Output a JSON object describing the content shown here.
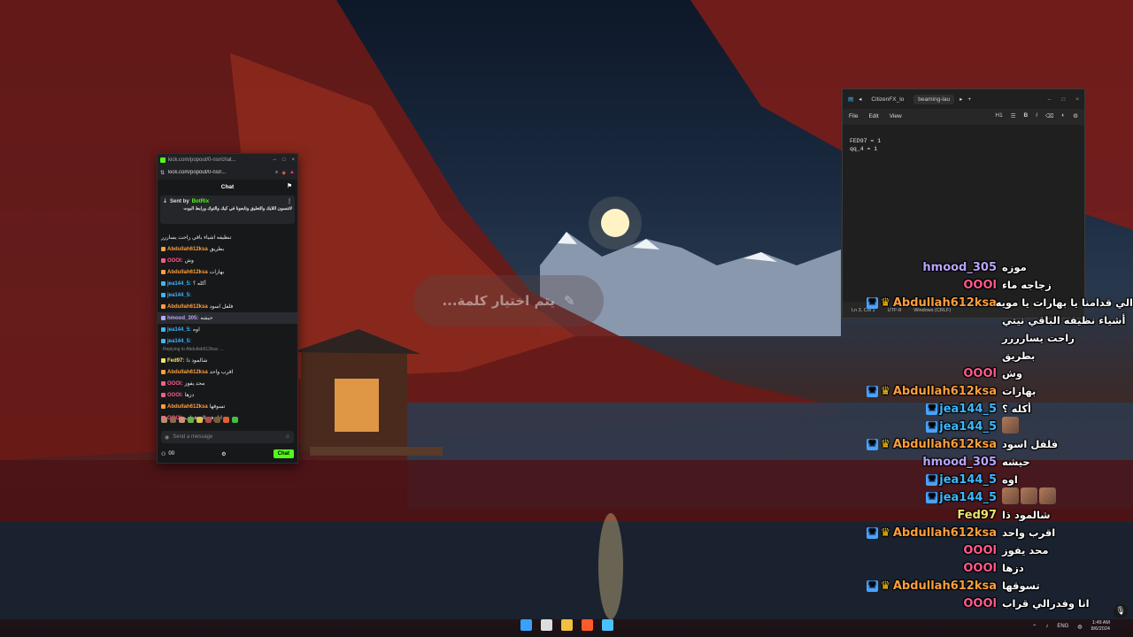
{
  "kick": {
    "tab_title": "kick.com/popout/0-nsr/chat...",
    "url": "kick.com/popout/0-nsr/...",
    "chat_title": "Chat",
    "pinned": {
      "sent_by": "Sent by",
      "bot_name": "BotRix",
      "message": "لاتنسون اللايك والتعليق وتابعونا في كيك والتوك ورابط البوت"
    },
    "messages": [
      {
        "user": "",
        "text": "تنظيفه اشياء باقي راحت يساررر"
      },
      {
        "user": "Abdullah612ksa",
        "text": "بطريق",
        "color": "#ff9e3d"
      },
      {
        "user": "OOOl:",
        "text": "وش",
        "color": "#ff5a8c"
      },
      {
        "user": "Abdullah612ksa",
        "text": "بهارات",
        "color": "#ff9e3d"
      },
      {
        "user": "jea144_5:",
        "text": "أكله ؟",
        "color": "#3db8ff"
      },
      {
        "user": "jea144_5:",
        "text": "",
        "color": "#3db8ff"
      },
      {
        "user": "Abdullah612ksa",
        "text": "فلفل اسود",
        "color": "#ff9e3d"
      },
      {
        "user": "hmood_305:",
        "text": "حيشه",
        "color": "#b9a4ff"
      },
      {
        "user": "jea144_5:",
        "text": "اوه",
        "color": "#3db8ff"
      },
      {
        "user": "jea144_5:",
        "text": "",
        "color": "#3db8ff"
      },
      {
        "user": "Fed97:",
        "text": "شالمود ذا",
        "color": "#f0e26a"
      },
      {
        "user": "Abdullah612ksa",
        "text": "اقرب واحد",
        "color": "#ff9e3d"
      },
      {
        "user": "OOOl:",
        "text": "محد يفوز",
        "color": "#ff5a8c"
      },
      {
        "user": "OOOl:",
        "text": "دزها",
        "color": "#ff5a8c"
      },
      {
        "user": "Abdullah612ksa",
        "text": "تسوقها",
        "color": "#ff9e3d"
      },
      {
        "user": "OOOl:",
        "text": "انا وفدرالي قراب",
        "color": "#ff5a8c"
      }
    ],
    "reply_text": "Replying to Abdullah612ksa: ...",
    "send_placeholder": "Send a message",
    "chat_button": "Chat",
    "viewer_count": "00"
  },
  "notepad": {
    "tab1": "CitizenFX_lo",
    "tab2": "beaming-lau",
    "menu": [
      "File",
      "Edit",
      "View"
    ],
    "heading": "H1",
    "lines": [
      "FED97 = 1",
      "qq_4 = 1"
    ],
    "status": [
      "Ln 3, Col 1",
      "UTF-8",
      "Windows (CRLF)"
    ]
  },
  "prompt_text": "يتم اختيار كلمة...",
  "overlay": [
    {
      "user": "hmood_305",
      "text": "موزه",
      "color": "#b9a4ff",
      "badges": []
    },
    {
      "user": "OOOl",
      "text": "زجاجه ماء",
      "color": "#ff5a8c",
      "badges": []
    },
    {
      "user": "Abdullah612ksa",
      "text": "الي قدامنا يا بهارات يا مويه",
      "color": "#ff9e3d",
      "badges": [
        "tool",
        "crown"
      ]
    },
    {
      "user": "",
      "text": "أشياء نظيفه الباقي نيتي",
      "color": "#ffffff",
      "badges": []
    },
    {
      "user": "",
      "text": "راحت يسارررر",
      "color": "#ffffff",
      "badges": []
    },
    {
      "user": "",
      "text": "بطريق",
      "color": "#ffffff",
      "badges": []
    },
    {
      "user": "OOOl",
      "text": "وش",
      "color": "#ff5a8c",
      "badges": []
    },
    {
      "user": "Abdullah612ksa",
      "text": "بهارات",
      "color": "#ff9e3d",
      "badges": [
        "tool",
        "crown"
      ]
    },
    {
      "user": "jea144_5",
      "text": "أكله ؟",
      "color": "#3db8ff",
      "badges": [
        "tool"
      ]
    },
    {
      "user": "jea144_5",
      "text": "",
      "color": "#3db8ff",
      "badges": [
        "tool"
      ],
      "images": 1
    },
    {
      "user": "Abdullah612ksa",
      "text": "فلفل اسود",
      "color": "#ff9e3d",
      "badges": [
        "tool",
        "crown"
      ]
    },
    {
      "user": "hmood_305",
      "text": "حيشه",
      "color": "#b9a4ff",
      "badges": []
    },
    {
      "user": "jea144_5",
      "text": "اوه",
      "color": "#3db8ff",
      "badges": [
        "tool"
      ]
    },
    {
      "user": "jea144_5",
      "text": "",
      "color": "#3db8ff",
      "badges": [
        "tool"
      ],
      "images": 3
    },
    {
      "user": "Fed97",
      "text": "شالمود ذا",
      "color": "#f0e26a",
      "badges": []
    },
    {
      "user": "Abdullah612ksa",
      "text": "اقرب واحد",
      "color": "#ff9e3d",
      "badges": [
        "tool",
        "crown"
      ]
    },
    {
      "user": "OOOl",
      "text": "محد يفوز",
      "color": "#ff5a8c",
      "badges": []
    },
    {
      "user": "OOOl",
      "text": "دزها",
      "color": "#ff5a8c",
      "badges": []
    },
    {
      "user": "Abdullah612ksa",
      "text": "تسوقها",
      "color": "#ff9e3d",
      "badges": [
        "tool",
        "crown"
      ]
    },
    {
      "user": "OOOl",
      "text": "انا وفدرالي قراب",
      "color": "#ff5a8c",
      "badges": []
    }
  ],
  "taskbar": {
    "lang": "ENG",
    "time": "1:49 AM",
    "date": "8/6/2024"
  }
}
